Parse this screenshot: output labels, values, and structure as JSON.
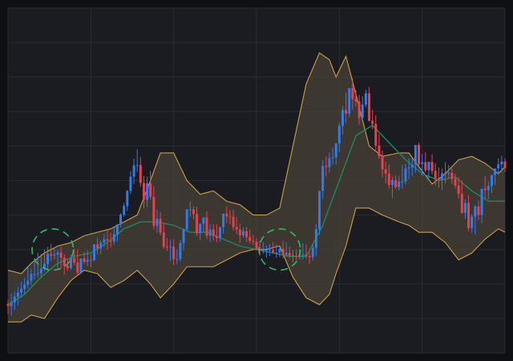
{
  "chart_data": {
    "type": "candlestick",
    "title": "",
    "xlabel": "",
    "ylabel": "",
    "grid": true,
    "legend": "none",
    "colors": {
      "up": "#2f7cf0",
      "down": "#e8404f",
      "bollinger_band": "#c9a04a",
      "band_fill": "#4a4236",
      "moving_average": "#1f8a55",
      "highlight_circle": "#34b866",
      "background": "#1b1c21",
      "grid": "#2a2c33"
    },
    "ylim": [
      0,
      100
    ],
    "x": [
      0,
      2,
      4,
      6,
      8,
      10,
      12,
      14,
      16,
      18,
      20,
      22,
      24,
      26,
      28,
      30,
      32,
      34,
      36,
      38,
      40,
      42,
      44,
      46,
      48,
      50,
      52,
      54,
      56,
      58,
      60,
      62,
      64,
      66,
      68,
      70,
      72,
      74,
      76,
      78,
      80,
      82,
      84,
      86,
      88,
      90,
      92,
      94,
      96,
      98,
      100,
      102,
      104,
      106,
      108,
      110,
      112,
      114,
      116,
      118,
      120,
      122,
      124,
      126,
      128,
      130,
      132,
      134,
      136,
      138,
      140,
      142,
      144,
      146,
      148,
      150,
      152,
      154,
      156,
      158,
      160,
      162,
      164,
      166,
      168,
      170,
      172,
      174,
      176,
      178,
      180,
      182,
      184,
      186,
      188,
      190,
      192,
      194,
      196,
      198,
      200,
      202,
      204,
      206,
      208,
      210,
      212,
      214,
      216,
      218,
      220,
      222,
      224,
      226,
      228,
      230,
      232,
      234,
      236,
      238,
      240,
      242,
      244,
      246,
      248,
      250,
      252,
      254,
      256,
      258,
      260,
      262,
      264,
      266,
      268,
      270,
      272,
      274,
      276,
      278,
      280,
      282,
      284,
      286,
      288,
      290,
      292,
      294,
      296,
      298,
      300
    ],
    "series": [
      {
        "kind": "candles",
        "open": [
          14.2,
          13.6,
          14.7,
          16.3,
          17.5,
          18.6,
          19.8,
          20.9,
          22.9,
          22.9,
          23.1,
          24.4,
          25.8,
          28.7,
          28.2,
          28.5,
          29.1,
          27.6,
          25.3,
          24.6,
          27.6,
          26.2,
          23.3,
          27.4,
          26.4,
          27.0,
          26.9,
          31.5,
          30.3,
          32.0,
          33.0,
          32.6,
          32.3,
          34.4,
          37.3,
          40.1,
          42.6,
          47.0,
          51.1,
          54.4,
          54.5,
          49.3,
          44.4,
          49.2,
          45.3,
          36.8,
          38.9,
          34.9,
          30.8,
          30.6,
          30.8,
          27.2,
          27.2,
          31.9,
          35.9,
          41.6,
          41.6,
          40.3,
          34.7,
          37.5,
          39.3,
          34.0,
          35.8,
          33.9,
          33.3,
          36.5,
          40.4,
          39.6,
          39.5,
          36.5,
          35.8,
          34.1,
          35.3,
          33.6,
          32.5,
          32.3,
          30.0,
          29.6,
          29.8,
          29.9,
          29.9,
          29.1,
          29.1,
          30.2,
          28.5,
          29.0,
          28.3,
          28.1,
          28.0,
          28.3,
          28.5,
          28.1,
          27.8,
          30.5,
          35.9,
          47.0,
          54.2,
          53.9,
          56.5,
          56.7,
          60.8,
          65.8,
          70.4,
          69.4,
          76.8,
          73.6,
          72.9,
          68.2,
          72.0,
          75.3,
          67.3,
          66.4,
          60.1,
          57.0,
          53.2,
          52.0,
          48.7,
          50.1,
          48.1,
          49.7,
          49.7,
          53.5,
          53.8,
          54.6,
          60.3,
          54.8,
          55.3,
          53.0,
          55.4,
          52.8,
          50.5,
          50.1,
          52.1,
          52.0,
          52.2,
          50.5,
          48.5,
          46.1,
          40.6,
          43.5,
          36.2,
          39.5,
          42.5,
          40.0,
          47.6,
          47.2,
          48.4,
          51.6,
          53.5,
          54.7,
          55.5
        ],
        "high": [
          15.4,
          17.2,
          17.8,
          19.2,
          20.6,
          21.7,
          24.8,
          24.4,
          27.1,
          29.1,
          28.7,
          30.0,
          30.8,
          31.6,
          30.6,
          29.9,
          30.8,
          28.6,
          27.4,
          28.5,
          30.2,
          30.0,
          26.3,
          29.4,
          29.7,
          28.7,
          29.4,
          33.3,
          32.6,
          34.6,
          35.9,
          34.8,
          36.4,
          37.1,
          40.5,
          43.5,
          47.2,
          52.7,
          56.3,
          59.0,
          56.8,
          51.3,
          51.1,
          52.8,
          48.3,
          41.6,
          40.8,
          37.6,
          33.3,
          32.8,
          32.9,
          30.0,
          32.7,
          36.0,
          41.7,
          44.0,
          42.6,
          42.4,
          37.3,
          39.3,
          41.1,
          37.3,
          37.4,
          37.3,
          36.3,
          40.1,
          42.5,
          41.4,
          41.6,
          39.4,
          37.5,
          36.4,
          36.5,
          35.8,
          34.2,
          33.3,
          32.5,
          32.1,
          31.1,
          31.6,
          32.1,
          31.5,
          30.6,
          32.5,
          32.1,
          30.8,
          29.9,
          30.0,
          30.1,
          31.8,
          31.4,
          29.3,
          31.5,
          37.4,
          44.6,
          55.9,
          57.0,
          58.1,
          59.5,
          60.6,
          66.7,
          71.6,
          75.5,
          75.5,
          79.7,
          76.1,
          74.8,
          74.4,
          76.3,
          77.1,
          70.5,
          68.9,
          63.5,
          58.7,
          55.4,
          54.6,
          51.1,
          51.5,
          51.4,
          54.5,
          54.8,
          56.4,
          56.3,
          56.9,
          61.0,
          57.7,
          58.2,
          55.5,
          57.6,
          55.0,
          53.8,
          53.5,
          55.3,
          54.5,
          53.6,
          52.0,
          51.1,
          50.0,
          44.6,
          45.8,
          40.3,
          42.9,
          44.2,
          45.2,
          51.3,
          49.7,
          51.6,
          53.5,
          56.4,
          57.2,
          56.4
        ],
        "low": [
          11.4,
          10.9,
          12.5,
          13.8,
          16.0,
          17.0,
          18.7,
          19.6,
          21.3,
          21.9,
          21.7,
          23.7,
          23.6,
          26.7,
          27.0,
          24.3,
          24.6,
          22.8,
          23.8,
          24.1,
          25.4,
          22.3,
          22.9,
          25.8,
          25.2,
          24.8,
          26.5,
          28.5,
          28.6,
          30.7,
          29.9,
          30.6,
          31.4,
          32.3,
          36.4,
          39.5,
          41.2,
          46.1,
          49.0,
          52.5,
          48.2,
          41.9,
          42.3,
          44.4,
          35.8,
          34.8,
          34.1,
          30.2,
          29.6,
          26.6,
          25.5,
          25.8,
          26.5,
          29.8,
          35.2,
          39.5,
          38.7,
          33.9,
          32.7,
          34.9,
          33.0,
          32.2,
          32.6,
          32.1,
          32.3,
          34.6,
          37.6,
          37.3,
          35.5,
          34.4,
          31.9,
          33.4,
          32.2,
          31.7,
          31.3,
          29.8,
          28.2,
          28.8,
          27.6,
          28.1,
          28.9,
          27.6,
          27.8,
          27.5,
          27.8,
          27.5,
          26.4,
          27.0,
          27.0,
          27.1,
          27.4,
          25.8,
          26.8,
          28.2,
          34.2,
          44.6,
          51.2,
          52.3,
          54.6,
          54.6,
          58.3,
          63.3,
          66.7,
          68.3,
          70.5,
          71.5,
          66.2,
          67.4,
          71.2,
          67.1,
          64.9,
          58.5,
          56.2,
          50.9,
          49.2,
          47.5,
          45.0,
          47.6,
          47.1,
          47.6,
          48.9,
          50.4,
          51.3,
          52.3,
          54.0,
          51.3,
          52.4,
          49.9,
          51.8,
          48.6,
          47.9,
          47.2,
          49.2,
          50.6,
          49.0,
          47.7,
          44.8,
          40.4,
          38.9,
          35.3,
          34.8,
          34.3,
          38.5,
          37.7,
          44.8,
          44.5,
          46.4,
          48.7,
          51.6,
          52.2,
          52.5
        ],
        "close": [
          13.6,
          14.7,
          16.3,
          17.5,
          18.6,
          19.8,
          20.9,
          22.9,
          22.9,
          23.1,
          24.4,
          25.8,
          28.7,
          28.2,
          28.5,
          29.1,
          27.6,
          25.3,
          24.6,
          27.6,
          26.2,
          23.3,
          27.4,
          26.4,
          27.0,
          26.9,
          31.5,
          30.3,
          32.0,
          33.0,
          32.6,
          32.3,
          34.4,
          37.3,
          40.1,
          42.6,
          47.0,
          51.1,
          54.4,
          54.5,
          49.3,
          44.4,
          49.2,
          45.3,
          36.8,
          38.9,
          34.9,
          30.8,
          30.6,
          30.8,
          27.2,
          27.2,
          31.9,
          35.9,
          41.6,
          41.6,
          40.3,
          34.7,
          37.5,
          39.3,
          34.0,
          35.8,
          33.9,
          33.3,
          36.5,
          40.4,
          39.6,
          39.5,
          36.5,
          35.8,
          34.1,
          35.3,
          33.6,
          32.5,
          32.3,
          30.0,
          29.6,
          29.8,
          29.9,
          29.9,
          29.1,
          29.1,
          30.2,
          28.5,
          29.0,
          28.3,
          28.1,
          28.0,
          28.3,
          28.5,
          28.1,
          27.8,
          30.5,
          35.9,
          47.0,
          54.2,
          53.9,
          56.5,
          56.7,
          60.8,
          65.8,
          70.4,
          69.4,
          76.8,
          73.6,
          72.9,
          68.2,
          72.0,
          75.3,
          67.3,
          66.4,
          60.1,
          57.0,
          53.2,
          52.0,
          48.7,
          50.1,
          48.1,
          49.7,
          49.7,
          53.5,
          53.8,
          54.6,
          60.3,
          54.8,
          55.3,
          53.0,
          55.4,
          52.8,
          50.5,
          50.1,
          52.1,
          52.0,
          52.2,
          50.5,
          48.5,
          46.1,
          40.6,
          43.5,
          36.2,
          39.5,
          42.5,
          40.0,
          47.6,
          47.2,
          48.4,
          51.6,
          53.5,
          54.7,
          55.5,
          53.6
        ]
      },
      {
        "kind": "bollinger",
        "x": [
          0,
          8,
          14,
          22,
          30,
          38,
          46,
          54,
          62,
          70,
          78,
          86,
          92,
          100,
          108,
          116,
          124,
          132,
          140,
          148,
          156,
          164,
          172,
          180,
          188,
          194,
          198,
          204,
          210,
          218,
          226,
          236,
          242,
          248,
          256,
          264,
          272,
          280,
          288,
          296,
          300
        ],
        "upper": [
          24,
          23,
          26,
          29,
          31,
          32,
          34,
          35,
          36,
          38,
          40,
          50,
          58,
          58,
          50,
          46,
          47,
          44,
          43,
          40,
          40,
          42,
          60,
          78,
          87,
          85,
          80,
          86,
          75,
          60,
          57,
          58,
          58,
          54,
          49,
          52,
          56,
          57,
          55,
          52,
          54
        ],
        "lower": [
          9,
          9,
          11,
          10,
          16,
          21,
          24,
          23,
          19,
          21,
          24,
          20,
          16,
          20,
          25,
          25,
          25,
          27,
          29,
          30,
          30,
          31,
          22,
          16,
          14,
          17,
          23,
          31,
          42,
          42,
          40,
          38,
          37,
          35,
          35,
          32,
          27,
          29,
          33,
          36,
          35
        ]
      },
      {
        "kind": "moving_average",
        "x": [
          0,
          10,
          20,
          30,
          40,
          50,
          60,
          70,
          80,
          90,
          100,
          110,
          120,
          130,
          140,
          150,
          160,
          170,
          180,
          190,
          200,
          210,
          220,
          230,
          240,
          250,
          260,
          270,
          280,
          290,
          300
        ],
        "values": [
          14,
          17,
          22,
          26,
          28,
          29,
          32,
          36,
          38,
          38,
          37,
          35,
          35,
          33,
          31,
          30,
          29,
          28,
          28,
          37,
          50,
          63,
          66,
          61,
          56,
          52,
          50,
          51,
          47,
          44,
          44
        ]
      }
    ],
    "annotations": [
      {
        "kind": "dashed_circle",
        "cx": 27,
        "cy": 30,
        "r": 13
      },
      {
        "kind": "dashed_circle",
        "cx": 164,
        "cy": 30,
        "r": 13
      }
    ]
  }
}
